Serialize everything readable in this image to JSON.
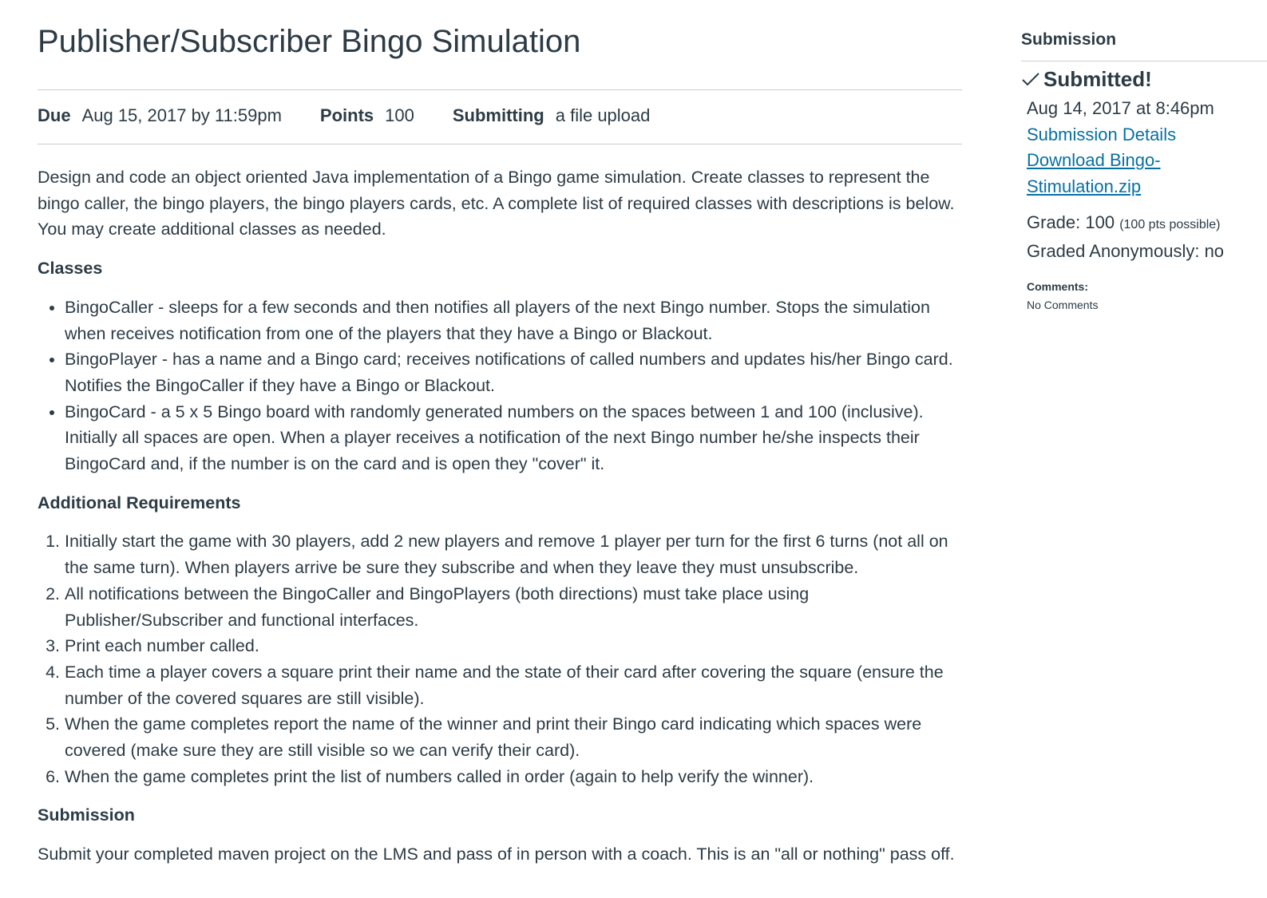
{
  "assignment": {
    "title": "Publisher/Subscriber Bingo Simulation",
    "due_label": "Due",
    "due_value": "Aug 15, 2017 by 11:59pm",
    "points_label": "Points",
    "points_value": "100",
    "submitting_label": "Submitting",
    "submitting_value": "a file upload"
  },
  "description": {
    "intro": "Design and code an object oriented Java implementation of a Bingo game simulation.  Create classes to represent the bingo caller, the bingo players, the bingo players cards, etc.  A complete list of required classes with descriptions is below.  You may create additional classes as needed.",
    "classes_heading": "Classes",
    "classes": [
      "BingoCaller - sleeps for a few seconds and then notifies all players of the next Bingo number.  Stops the simulation when receives notification from one of the players that they have a Bingo or Blackout.",
      "BingoPlayer - has a name and a Bingo card; receives notifications of called numbers and updates his/her Bingo card.  Notifies the BingoCaller if they have a Bingo or Blackout.",
      "BingoCard - a 5 x 5 Bingo board with randomly generated numbers on the spaces between 1 and 100 (inclusive).  Initially all spaces are open.  When a player receives a notification of the next Bingo number he/she inspects their BingoCard and, if the number is on the card and is open they \"cover\" it."
    ],
    "requirements_heading": "Additional Requirements",
    "requirements": [
      "Initially start the game with 30 players, add 2 new players and remove 1 player per turn for the first 6 turns (not all on the same turn).  When players arrive be sure they subscribe and when they leave they must unsubscribe.",
      "All notifications between the BingoCaller and BingoPlayers (both directions) must take place using Publisher/Subscriber and functional interfaces.",
      "Print each number called.",
      "Each time a player covers a square print their name and the state of their card after covering the square (ensure the number of the covered squares are still visible).",
      "When the game completes report the name of the winner and print their Bingo card indicating which spaces were covered (make sure they are still visible so we can verify their card).",
      "When the game completes print the list of numbers called in order (again to help verify the winner)."
    ],
    "submission_heading": "Submission",
    "submission_text": "Submit your completed maven project on the LMS and pass of in person with a coach.  This is an \"all or nothing\" pass off."
  },
  "sidebar": {
    "header": "Submission",
    "status": "Submitted!",
    "submitted_at": "Aug 14, 2017 at 8:46pm",
    "details_link": "Submission Details",
    "download_link": "Download Bingo-Stimulation.zip",
    "grade_label": "Grade: 100",
    "grade_possible": "(100 pts possible)",
    "anonymous": "Graded Anonymously: no",
    "comments_label": "Comments:",
    "comments_value": "No Comments"
  },
  "colors": {
    "text": "#2d3b45",
    "link": "#0770a3",
    "divider": "#c7cdd1"
  }
}
